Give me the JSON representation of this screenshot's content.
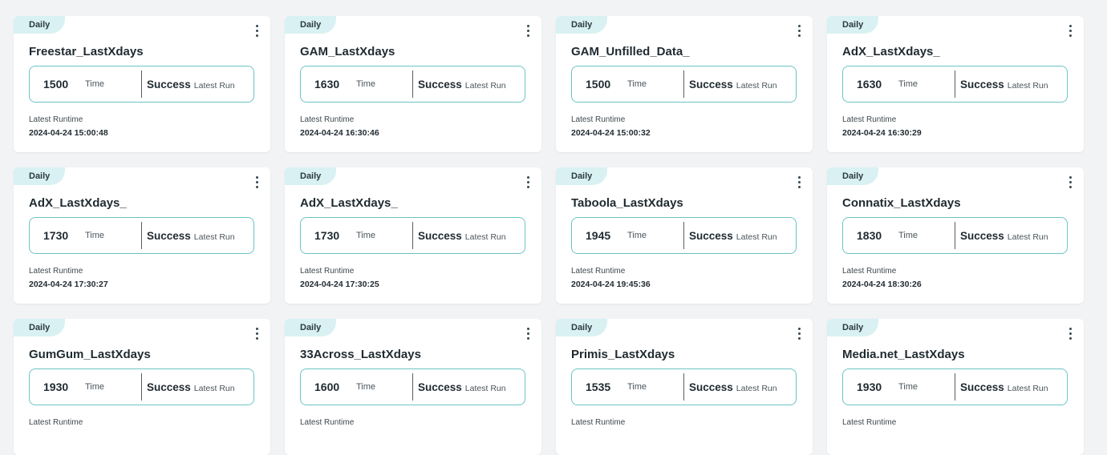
{
  "cards": [
    {
      "frequency": "Daily",
      "name": "Freestar_LastXdays",
      "time_value": "1500",
      "time_label": "Time",
      "status": "Success",
      "status_label": "Latest Run",
      "runtime_label": "Latest Runtime",
      "runtime": "2024-04-24 15:00:48"
    },
    {
      "frequency": "Daily",
      "name": "GAM_LastXdays",
      "time_value": "1630",
      "time_label": "Time",
      "status": "Success",
      "status_label": "Latest Run",
      "runtime_label": "Latest Runtime",
      "runtime": "2024-04-24 16:30:46"
    },
    {
      "frequency": "Daily",
      "name": "GAM_Unfilled_Data_",
      "time_value": "1500",
      "time_label": "Time",
      "status": "Success",
      "status_label": "Latest Run",
      "runtime_label": "Latest Runtime",
      "runtime": "2024-04-24 15:00:32"
    },
    {
      "frequency": "Daily",
      "name": "AdX_LastXdays_",
      "time_value": "1630",
      "time_label": "Time",
      "status": "Success",
      "status_label": "Latest Run",
      "runtime_label": "Latest Runtime",
      "runtime": "2024-04-24 16:30:29"
    },
    {
      "frequency": "Daily",
      "name": "AdX_LastXdays_",
      "time_value": "1730",
      "time_label": "Time",
      "status": "Success",
      "status_label": "Latest Run",
      "runtime_label": "Latest Runtime",
      "runtime": "2024-04-24 17:30:27"
    },
    {
      "frequency": "Daily",
      "name": "AdX_LastXdays_",
      "time_value": "1730",
      "time_label": "Time",
      "status": "Success",
      "status_label": "Latest Run",
      "runtime_label": "Latest Runtime",
      "runtime": "2024-04-24 17:30:25"
    },
    {
      "frequency": "Daily",
      "name": "Taboola_LastXdays",
      "time_value": "1945",
      "time_label": "Time",
      "status": "Success",
      "status_label": "Latest Run",
      "runtime_label": "Latest Runtime",
      "runtime": "2024-04-24 19:45:36"
    },
    {
      "frequency": "Daily",
      "name": "Connatix_LastXdays",
      "time_value": "1830",
      "time_label": "Time",
      "status": "Success",
      "status_label": "Latest Run",
      "runtime_label": "Latest Runtime",
      "runtime": "2024-04-24 18:30:26"
    },
    {
      "frequency": "Daily",
      "name": "GumGum_LastXdays",
      "time_value": "1930",
      "time_label": "Time",
      "status": "Success",
      "status_label": "Latest Run",
      "runtime_label": "Latest Runtime",
      "runtime": ""
    },
    {
      "frequency": "Daily",
      "name": "33Across_LastXdays",
      "time_value": "1600",
      "time_label": "Time",
      "status": "Success",
      "status_label": "Latest Run",
      "runtime_label": "Latest Runtime",
      "runtime": ""
    },
    {
      "frequency": "Daily",
      "name": "Primis_LastXdays",
      "time_value": "1535",
      "time_label": "Time",
      "status": "Success",
      "status_label": "Latest Run",
      "runtime_label": "Latest Runtime",
      "runtime": ""
    },
    {
      "frequency": "Daily",
      "name": "Media.net_LastXdays",
      "time_value": "1930",
      "time_label": "Time",
      "status": "Success",
      "status_label": "Latest Run",
      "runtime_label": "Latest Runtime",
      "runtime": ""
    }
  ],
  "icons": {
    "menu": "more-vertical-icon"
  },
  "colors": {
    "badge_bg": "#d9f1f2",
    "box_border": "#6cc4c7",
    "page_bg": "#f1f3f4"
  }
}
